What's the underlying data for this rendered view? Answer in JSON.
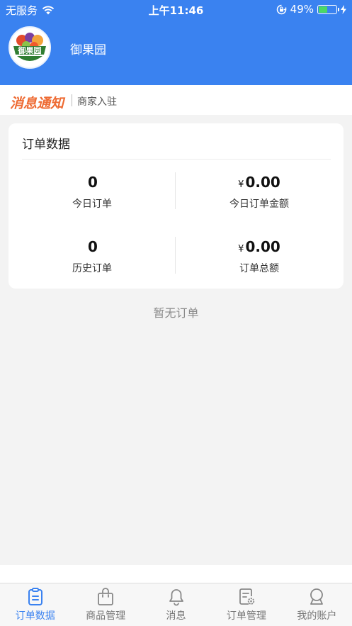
{
  "status_bar": {
    "carrier": "无服务",
    "time": "上午11:46",
    "battery": "49%"
  },
  "shop": {
    "name": "御果园",
    "logo_text": "御果园"
  },
  "notice": {
    "tag": "消息通知",
    "text": "商家入驻"
  },
  "order_card": {
    "title": "订单数据",
    "stats": [
      {
        "value": "0",
        "label": "今日订单",
        "currency": ""
      },
      {
        "value": "0.00",
        "label": "今日订单金额",
        "currency": "¥"
      },
      {
        "value": "0",
        "label": "历史订单",
        "currency": ""
      },
      {
        "value": "0.00",
        "label": "订单总额",
        "currency": "¥"
      }
    ]
  },
  "empty_text": "暂无订单",
  "tabs": [
    {
      "label": "订单数据",
      "icon": "clipboard-icon",
      "active": true
    },
    {
      "label": "商品管理",
      "icon": "bag-icon",
      "active": false
    },
    {
      "label": "消息",
      "icon": "bell-icon",
      "active": false
    },
    {
      "label": "订单管理",
      "icon": "document-gear-icon",
      "active": false
    },
    {
      "label": "我的账户",
      "icon": "user-icon",
      "active": false
    }
  ],
  "colors": {
    "header": "#3a82f0",
    "accent": "#3a82f0",
    "notice_tag": "#ee6a32",
    "battery": "#4cd964"
  }
}
